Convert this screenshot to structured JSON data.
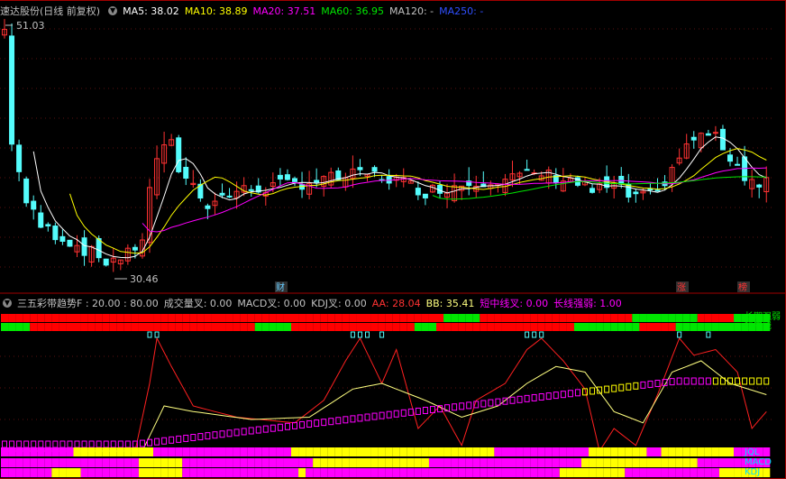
{
  "colors": {
    "up": "#ff3232",
    "down": "#54fcfc",
    "ma5": "#ffffff",
    "ma10": "#ffff00",
    "ma20": "#ff00ff",
    "ma60": "#00e600",
    "ma120": "#c0c0c0",
    "ma250": "#3050ff",
    "bg": "#000000",
    "border": "#a00000"
  },
  "main": {
    "title": "速达股份(日线 前复权)",
    "ma": [
      {
        "label": "MA5: 38.02",
        "color": "#ffffff"
      },
      {
        "label": "MA10: 38.89",
        "color": "#ffff00"
      },
      {
        "label": "MA20: 37.51",
        "color": "#ff00ff"
      },
      {
        "label": "MA60: 36.95",
        "color": "#00e600"
      },
      {
        "label": "MA120: -",
        "color": "#c0c0c0"
      },
      {
        "label": "MA250: -",
        "color": "#3050ff"
      }
    ],
    "high_label": "51.03",
    "low_label": "30.46",
    "markers": {
      "cai": "财",
      "zhang": "涨",
      "bang": "榜"
    }
  },
  "indicator": {
    "title": "三五彩带趋势F : 20.00 : 80.00",
    "items": [
      {
        "label": "成交量叉: 0.00",
        "color": "#c0c0c0"
      },
      {
        "label": "MACD叉: 0.00",
        "color": "#c0c0c0"
      },
      {
        "label": "KDJ叉: 0.00",
        "color": "#c0c0c0"
      },
      {
        "label": "AA: 28.04",
        "color": "#ff3232"
      },
      {
        "label": "BB: 35.41",
        "color": "#ffff80"
      },
      {
        "label": "短中线叉: 0.00",
        "color": "#ff00ff"
      },
      {
        "label": "长线强弱: 1.00",
        "color": "#ff00ff"
      }
    ],
    "band_labels": [
      "长期强弱",
      "短中线",
      "JQL",
      "MACD",
      "KDJ"
    ]
  },
  "chart_data": {
    "type": "candlestick",
    "ylim": [
      29.5,
      52.5
    ],
    "high": 51.03,
    "low": 30.46,
    "candles": [
      [
        null,
        null,
        null,
        null
      ],
      [
        0,
        0,
        0,
        0
      ]
    ]
  }
}
